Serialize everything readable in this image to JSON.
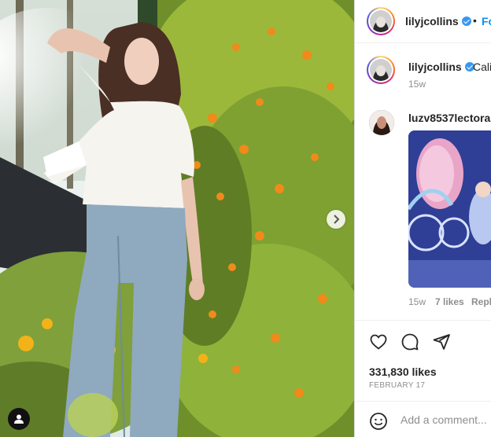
{
  "header": {
    "username": "lilyjcollins",
    "follow_label": "Fo"
  },
  "caption": {
    "username": "lilyjcollins",
    "text": "Cali",
    "age": "15w"
  },
  "comment": {
    "username": "luzv8537lectora",
    "age": "15w",
    "likes": "7 likes",
    "reply_label": "Repl"
  },
  "post": {
    "likes": "331,830 likes",
    "date": "FEBRUARY 17"
  },
  "add_comment": {
    "placeholder": "Add a comment..."
  },
  "icons": {
    "next": "chevron-right-icon",
    "tagged": "user-icon",
    "like": "heart-icon",
    "comment": "comment-icon",
    "share": "send-icon",
    "emoji": "emoji-icon",
    "verified": "verified-badge-icon"
  },
  "colors": {
    "link": "#0095f6",
    "text": "#262626",
    "muted": "#8e8e8e",
    "verified": "#3897f0"
  }
}
